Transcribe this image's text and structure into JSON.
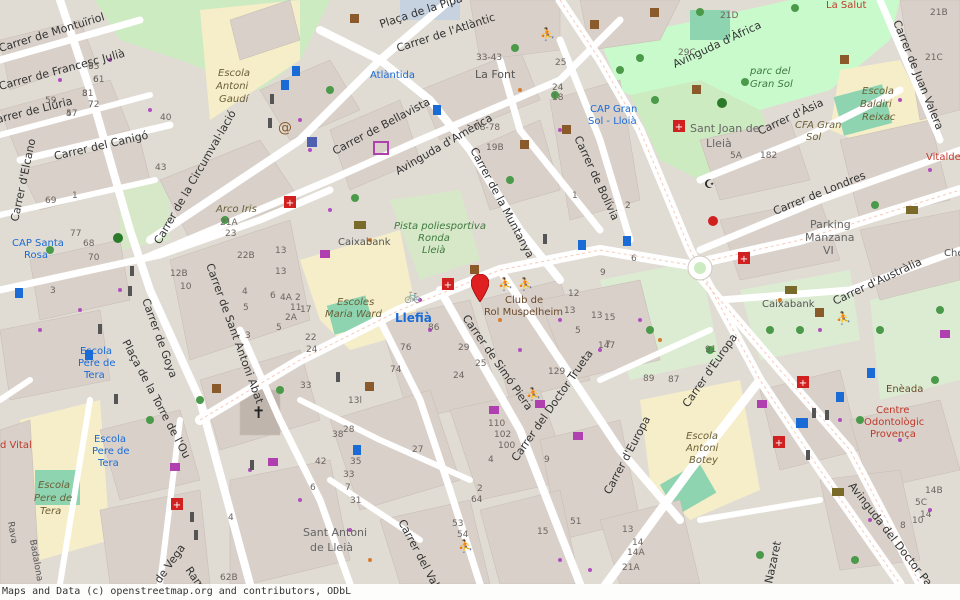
{
  "streets": {
    "montuiriol": "Carrer de Montuïriol",
    "francesc_julia": "Carrer de Francesc Julià",
    "lluria": "Carrer de Llúria",
    "caniga": "Carrer del Canigó",
    "elcano": "Carrer d'Elcano",
    "circumval": "Carrer de la Circumval·lació",
    "bellavista": "Carrer de Bellavista",
    "america": "Avinguda d'Amèrica",
    "muntanya": "Carrer de la Muntanya",
    "bolivia": "Carrer de Bolívia",
    "africa": "Avinguda d'Àfrica",
    "asia": "Carrer d'Àsia",
    "londres": "Carrer de Londres",
    "australia": "Carrer d'Austràlia",
    "juan_valera": "Carrer de Juan Valera",
    "sant_antoni_abat": "Carrer de Sant Antoni Abat",
    "goya": "Carrer de Goya",
    "placa_torre": "Plaça de la Torre de l'Ou",
    "simo_piera": "Carrer de Simó Piera",
    "doctor_trueta": "Carrer del Doctor Trueta",
    "europa": "Carrer d'Europa",
    "europa2": "Carrer d'Europa",
    "doctor_pasteur": "Avinguda del Doctor Pasteur",
    "valles": "Carrer del Vallès",
    "vega": "de Vega",
    "ramon": "Ramon",
    "atlantic": "Carrer de l'Atlàntic",
    "placa_pi": "Plaça de la Pipa",
    "nazaret": "Nazaret"
  },
  "places": {
    "atlantida": "Atlàntida",
    "la_font": "La Font",
    "escola_gaudi_1": "Escola",
    "escola_gaudi_2": "Antoni",
    "escola_gaudi_3": "Gaudí",
    "cap_gran_sol_1": "CAP Gran",
    "cap_gran_sol_2": "Sol - Lloià",
    "sant_joan_1": "Sant Joan de",
    "sant_joan_2": "Lleià",
    "parc_1": "parc del",
    "parc_2": "Gran Sol",
    "baldiri_1": "Escola",
    "baldiri_2": "Baldiri",
    "baldiri_3": "Reixac",
    "cfa_1": "CFA Gran",
    "cfa_2": "Sol",
    "arco_iris": "Arco Iris",
    "caixabank_1": "Caixabank",
    "caixabank_2": "Caixabank",
    "pista_1": "Pista poliesportiva",
    "pista_2": "Ronda",
    "pista_3": "Lleià",
    "parking_1": "Parking",
    "parking_2": "Manzana",
    "parking_3": "VI",
    "cap_santa_1": "CAP Santa",
    "cap_santa_2": "Rosa",
    "escoles_1": "Escoles",
    "escoles_2": "Maria Ward",
    "llefia": "Llefià",
    "club_1": "Club de",
    "club_2": "Rol Muspelheim",
    "escola_pere_1": "Escola",
    "escola_pere_2": "Pere de",
    "escola_pere_3": "Tera",
    "escola_pere_b1": "Escola",
    "escola_pere_b2": "Pere de",
    "escola_pere_b3": "Tera",
    "escola_pere_c1": "Escola",
    "escola_pere_c2": "Pere de",
    "escola_pere_c3": "Tera",
    "escola_botey_1": "Escola",
    "escola_botey_2": "Antoni",
    "escola_botey_3": "Botey",
    "sant_antoni_1": "Sant Antoni",
    "sant_antoni_2": "de Lleià",
    "eneada": "Enèada",
    "centre_odont_1": "Centre",
    "centre_odont_2": "Odontològic",
    "centre_odont_3": "Provença",
    "la_salut": "La Salut",
    "vitalde": "Vitalde",
    "vital": "d Vital",
    "che": "Che",
    "badalona": "Badalona",
    "rava": "Rava"
  },
  "house_numbers": [
    "65",
    "61",
    "81",
    "72",
    "57",
    "59",
    "40",
    "43",
    "77",
    "1",
    "69",
    "68",
    "70",
    "12B",
    "10",
    "22B",
    "13",
    "21A",
    "23",
    "3",
    "4",
    "5",
    "13",
    "11",
    "2A",
    "2",
    "6",
    "17",
    "22",
    "24",
    "86",
    "76",
    "74",
    "29",
    "25",
    "24",
    "129",
    "147",
    "89",
    "87",
    "91",
    "28",
    "33",
    "31",
    "42",
    "27",
    "110",
    "102",
    "100",
    "4",
    "2",
    "19B",
    "68-78",
    "33-43",
    "25",
    "24",
    "18",
    "1",
    "2",
    "6",
    "9",
    "12",
    "13",
    "15",
    "5",
    "13",
    "7",
    "9",
    "15",
    "51",
    "53",
    "54",
    "64",
    "13",
    "14",
    "14A",
    "21A",
    "21B",
    "21C",
    "21D",
    "29C",
    "182",
    "5A",
    "5C",
    "14B",
    "14",
    "10",
    "8",
    "6",
    "7",
    "4",
    "62B",
    "35",
    "38",
    "13l",
    "33",
    "4A",
    "5",
    "3",
    "9",
    "6",
    "3",
    "7",
    "4"
  ],
  "attribution": "Maps and Data (c) openstreetmap.org and contributors, ODbL",
  "marker_color": "#e02020"
}
